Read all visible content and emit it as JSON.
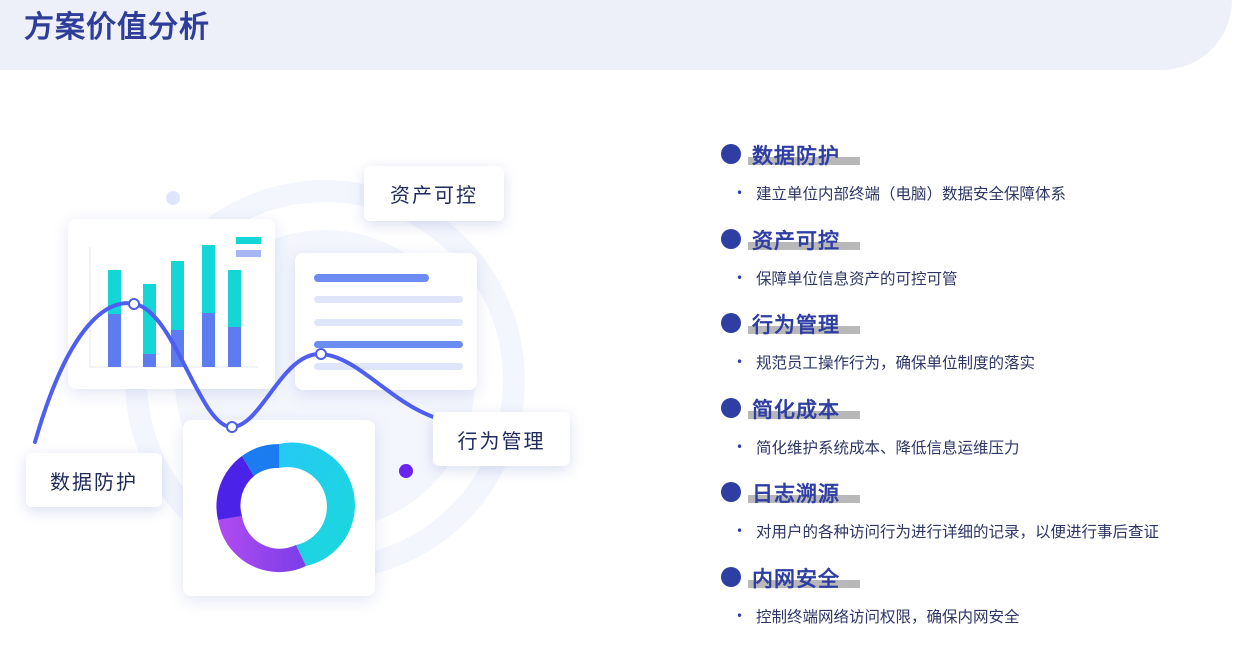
{
  "header": {
    "title": "方案价值分析"
  },
  "illustration": {
    "labels": {
      "asset": "资产可控",
      "behavior": "行为管理",
      "data": "数据防护"
    },
    "colors": {
      "accent": "#2f3ea3",
      "line": "#4e5ef0",
      "teal": "#14d6d6",
      "bar": "#5c7cf0"
    }
  },
  "features": [
    {
      "title": "数据防护",
      "desc": "建立单位内部终端（电脑）数据安全保障体系"
    },
    {
      "title": "资产可控",
      "desc": "保障单位信息资产的可控可管"
    },
    {
      "title": "行为管理",
      "desc": "规范员工操作行为，确保单位制度的落实"
    },
    {
      "title": "简化成本",
      "desc": "简化维护系统成本、降低信息运维压力"
    },
    {
      "title": "日志溯源",
      "desc": "对用户的各种访问行为进行详细的记录，以便进行事后查证"
    },
    {
      "title": "内网安全",
      "desc": "控制终端网络访问权限，确保内网安全"
    }
  ]
}
